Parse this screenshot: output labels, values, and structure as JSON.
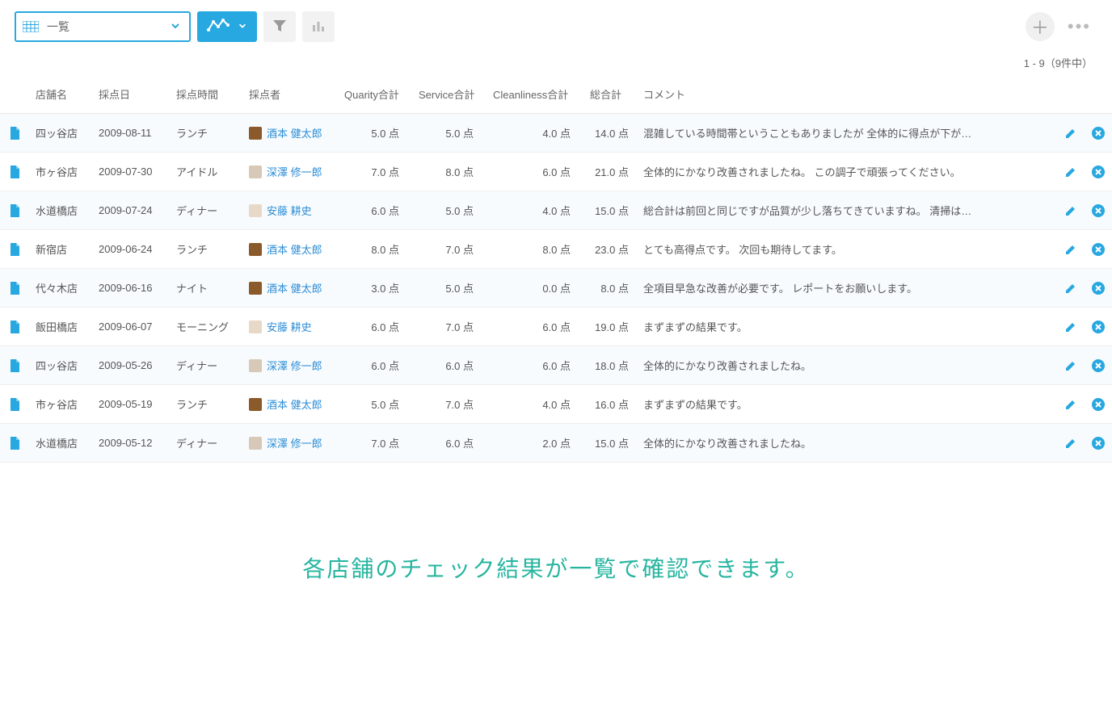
{
  "toolbar": {
    "view_label": "一覧"
  },
  "pager": {
    "text": "1 - 9（9件中）"
  },
  "columns": {
    "store": "店舗名",
    "date": "採点日",
    "time": "採点時間",
    "scorer": "採点者",
    "quality": "Quarity合計",
    "service": "Service合計",
    "clean": "Cleanliness合計",
    "total": "総合計",
    "comment": "コメント"
  },
  "score_suffix": " 点",
  "avatar_colors": {
    "酒本 健太郎": "#8b5a2b",
    "深澤 修一郎": "#d8c8b8",
    "安藤 耕史": "#e8d8c8"
  },
  "rows": [
    {
      "store": "四ッ谷店",
      "date": "2009-08-11",
      "time": "ランチ",
      "scorer": "酒本 健太郎",
      "quality": "5.0",
      "service": "5.0",
      "clean": "4.0",
      "total": "14.0",
      "comment": "混雑している時間帯ということもありましたが 全体的に得点が下が…"
    },
    {
      "store": "市ヶ谷店",
      "date": "2009-07-30",
      "time": "アイドル",
      "scorer": "深澤 修一郎",
      "quality": "7.0",
      "service": "8.0",
      "clean": "6.0",
      "total": "21.0",
      "comment": "全体的にかなり改善されましたね。 この調子で頑張ってください。"
    },
    {
      "store": "水道橋店",
      "date": "2009-07-24",
      "time": "ディナー",
      "scorer": "安藤 耕史",
      "quality": "6.0",
      "service": "5.0",
      "clean": "4.0",
      "total": "15.0",
      "comment": "総合計は前回と同じですが品質が少し落ちてきていますね。 清掃は…"
    },
    {
      "store": "新宿店",
      "date": "2009-06-24",
      "time": "ランチ",
      "scorer": "酒本 健太郎",
      "quality": "8.0",
      "service": "7.0",
      "clean": "8.0",
      "total": "23.0",
      "comment": "とても高得点です。 次回も期待してます。"
    },
    {
      "store": "代々木店",
      "date": "2009-06-16",
      "time": "ナイト",
      "scorer": "酒本 健太郎",
      "quality": "3.0",
      "service": "5.0",
      "clean": "0.0",
      "total": "8.0",
      "comment": "全項目早急な改善が必要です。 レポートをお願いします。"
    },
    {
      "store": "飯田橋店",
      "date": "2009-06-07",
      "time": "モーニング",
      "scorer": "安藤 耕史",
      "quality": "6.0",
      "service": "7.0",
      "clean": "6.0",
      "total": "19.0",
      "comment": "まずまずの結果です。"
    },
    {
      "store": "四ッ谷店",
      "date": "2009-05-26",
      "time": "ディナー",
      "scorer": "深澤 修一郎",
      "quality": "6.0",
      "service": "6.0",
      "clean": "6.0",
      "total": "18.0",
      "comment": "全体的にかなり改善されましたね。"
    },
    {
      "store": "市ヶ谷店",
      "date": "2009-05-19",
      "time": "ランチ",
      "scorer": "酒本 健太郎",
      "quality": "5.0",
      "service": "7.0",
      "clean": "4.0",
      "total": "16.0",
      "comment": "まずまずの結果です。"
    },
    {
      "store": "水道橋店",
      "date": "2009-05-12",
      "time": "ディナー",
      "scorer": "深澤 修一郎",
      "quality": "7.0",
      "service": "6.0",
      "clean": "2.0",
      "total": "15.0",
      "comment": "全体的にかなり改善されましたね。"
    }
  ],
  "caption": "各店舗のチェック結果が一覧で確認できます。"
}
